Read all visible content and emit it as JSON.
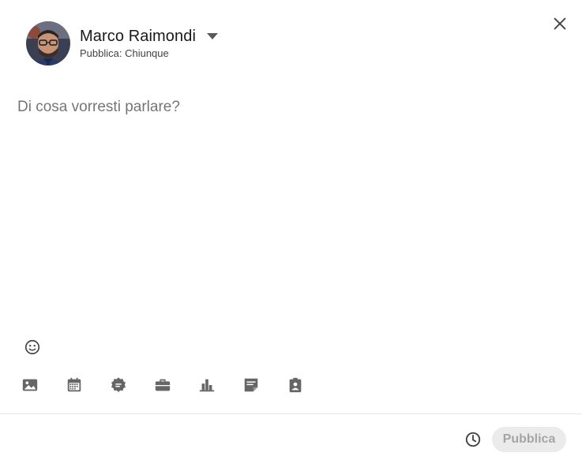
{
  "header": {
    "author_name": "Marco Raimondi",
    "visibility": "Pubblica: Chiunque",
    "avatar_icon": "user-photo-avatar",
    "dropdown_icon": "caret-down-icon",
    "close_icon": "close-icon"
  },
  "composer": {
    "placeholder": "Di cosa vorresti parlare?",
    "value": ""
  },
  "emoji": {
    "icon": "emoji-smile-icon"
  },
  "toolbar": {
    "items": [
      {
        "name": "photo",
        "icon": "image-icon"
      },
      {
        "name": "event",
        "icon": "calendar-icon"
      },
      {
        "name": "celebrate",
        "icon": "badge-icon"
      },
      {
        "name": "job",
        "icon": "briefcase-icon"
      },
      {
        "name": "poll",
        "icon": "bar-chart-icon"
      },
      {
        "name": "document",
        "icon": "document-icon"
      },
      {
        "name": "hiring",
        "icon": "clipboard-person-icon"
      }
    ]
  },
  "footer": {
    "schedule_icon": "clock-icon",
    "publish_label": "Pubblica",
    "publish_enabled": false
  },
  "colors": {
    "icon": "#666666",
    "placeholder": "#737373",
    "publish_disabled_bg": "#ebebeb",
    "publish_disabled_text": "#b3b3b3",
    "divider": "#e6e6e6"
  }
}
